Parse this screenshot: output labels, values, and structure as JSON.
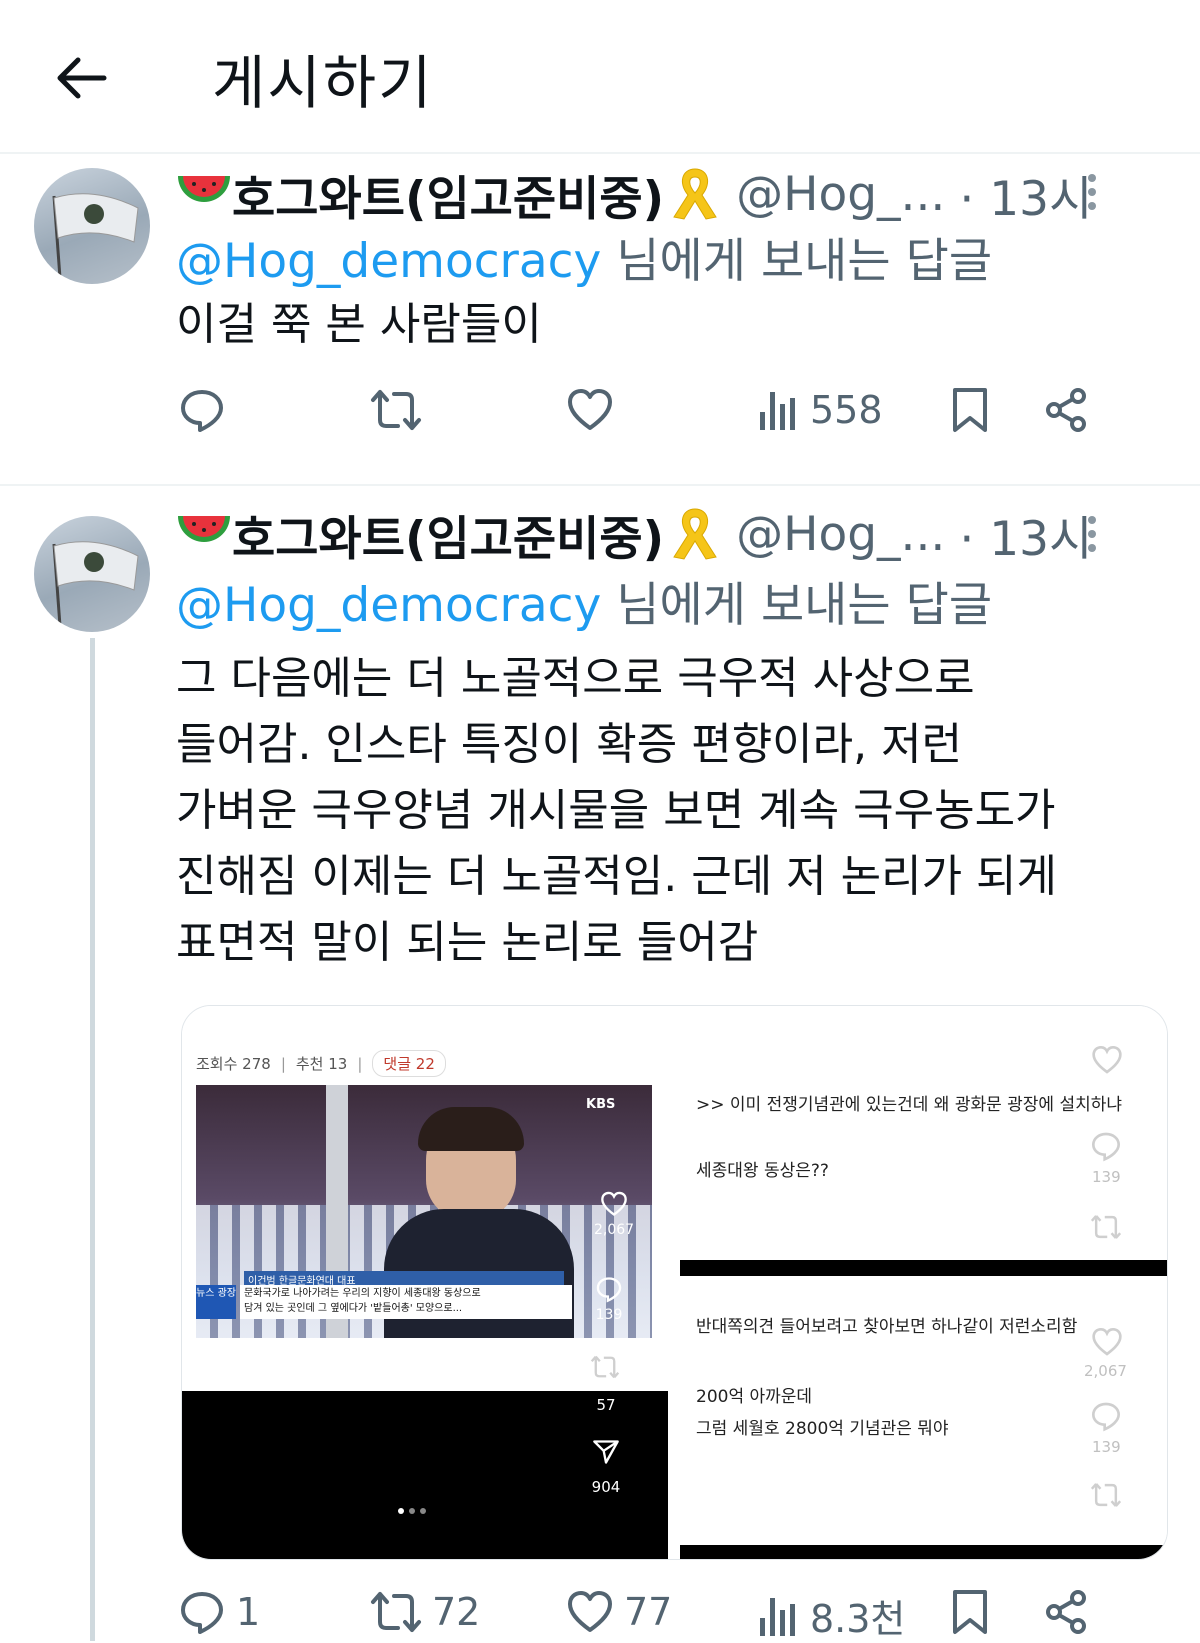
{
  "header": {
    "title": "게시하기"
  },
  "tweets": [
    {
      "name": "호그와트(임고준비중)",
      "handle": "@Hog_...",
      "time": "· 13시",
      "reply_prefix": "@Hog_democracy",
      "reply_suffix": " 님에게 보내는 답글",
      "text": "이걸 쭉 본 사람들이",
      "stats": {
        "replies": "",
        "retweets": "",
        "likes": "",
        "views": "558"
      }
    },
    {
      "name": "호그와트(임고준비중)",
      "handle": "@Hog_...",
      "time": "· 13시",
      "reply_prefix": "@Hog_democracy",
      "reply_suffix": " 님에게 보내는 답글",
      "text": "그 다음에는 더 노골적으로 극우적 사상으로\n들어감. 인스타 특징이 확증 편향이라, 저런\n가벼운 극우양념 개시물을 보면 계속 극우농도가\n진해짐 이제는 더 노골적임. 근데 저 논리가 되게\n표면적 말이 되는 논리로 들어감",
      "stats": {
        "replies": "1",
        "retweets": "72",
        "likes": "77",
        "views": "8.3천"
      },
      "media": {
        "left": {
          "meta_views": "조회수 278",
          "meta_recommend": "추천 13",
          "meta_comments": "댓글 22",
          "broadcaster": "KBS",
          "caption_name": "이건범 한글문화연대 대표",
          "caption_line1": "문화국가로 나아가려는 우리의 지향이 세종대왕 동상으로",
          "caption_line2": "담겨 있는 곳인데 그 옆에다가 '밭들어총' 모양으로...",
          "news_tag": "뉴스 광장",
          "likes": "2,067",
          "comments": "139",
          "reposts": "57",
          "shares": "904"
        },
        "right_top": {
          "line1": ">> 이미 전쟁기념관에 있는건데 왜 광화문 광장에 설치하냐",
          "line2": "세종대왕 동상은??",
          "comments": "139"
        },
        "right_bottom": {
          "line1": "반대쪽의견 들어보려고 찾아보면 하나같이 저런소리함",
          "line2": "200억 아까운데",
          "line3": "그럼 세월호 2800억 기념관은 뭐야",
          "likes": "2,067",
          "comments": "139"
        }
      }
    }
  ],
  "colors": {
    "link": "#1d9bf0",
    "muted": "#536471",
    "ribbon": "#f5c518",
    "separator": "#eff3f4"
  }
}
